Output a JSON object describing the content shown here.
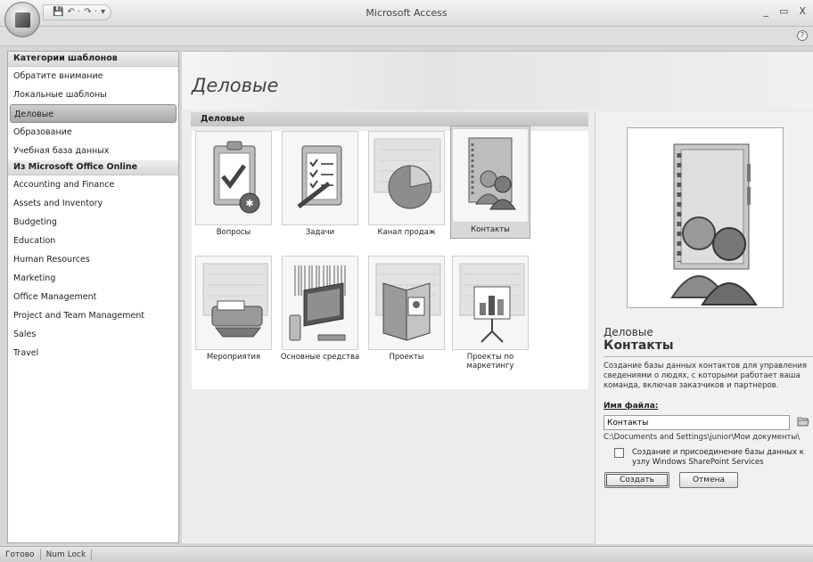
{
  "app": {
    "title": "Microsoft Access",
    "minimize": "_",
    "restore": "▭",
    "close": "X",
    "help": "?"
  },
  "qat": [
    "💾",
    "↶ ·",
    "↷ ·",
    "▾"
  ],
  "sidebar": {
    "section1_header": "Категории шаблонов",
    "section1_items": [
      "Обратите внимание",
      "Локальные шаблоны",
      "Деловые",
      "Образование",
      "Учебная база данных"
    ],
    "section2_header": "Из Microsoft Office Online",
    "section2_items": [
      "Accounting and Finance",
      "Assets and Inventory",
      "Budgeting",
      "Education",
      "Human Resources",
      "Marketing",
      "Office Management",
      "Project and Team Management",
      "Sales",
      "Travel"
    ],
    "selected": "Деловые"
  },
  "main": {
    "title": "Деловые",
    "section_label": "Деловые",
    "templates": [
      {
        "label": "Вопросы"
      },
      {
        "label": "Задачи"
      },
      {
        "label": "Канал продаж"
      },
      {
        "label": "Контакты",
        "selected": true
      },
      {
        "label": "Мероприятия"
      },
      {
        "label": "Основные средства"
      },
      {
        "label": "Проекты"
      },
      {
        "label": "Проекты по маркетингу"
      }
    ]
  },
  "preview": {
    "category": "Деловые",
    "name": "Контакты",
    "description": "Создание базы данных контактов для управления сведениями о людях, с которыми работает ваша команда, включая заказчиков и партнеров.",
    "filename_label": "Имя файла:",
    "filename_value": "Контакты",
    "path": "C:\\Documents and Settings\\junior\\Мои документы\\",
    "sharepoint_label": "Создание и присоединение базы данных к узлу Windows SharePoint Services",
    "create_button": "Создать",
    "cancel_button": "Отмена"
  },
  "status": {
    "ready": "Готово",
    "numlock": "Num Lock"
  }
}
